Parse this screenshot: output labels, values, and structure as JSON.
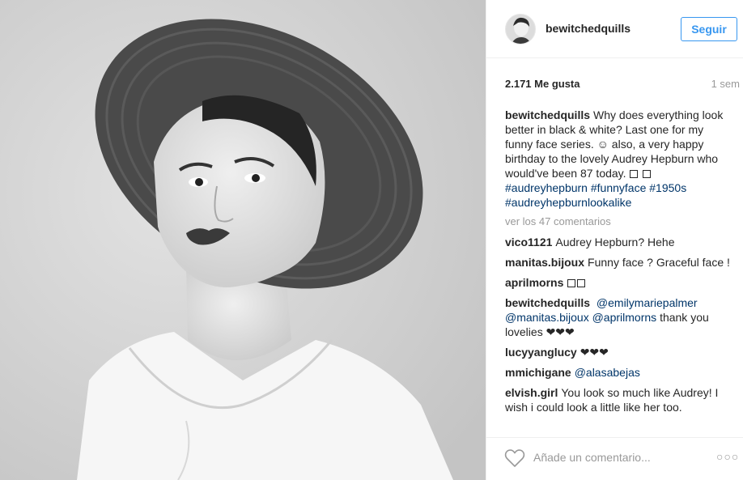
{
  "post": {
    "username": "bewitchedquills",
    "follow_label": "Seguir",
    "likes": "2.171 Me gusta",
    "time": "1 sem",
    "caption": {
      "user": "bewitchedquills",
      "text_1": "Why does everything look better in black & white? Last one for my funny face series. ☺ also, a very happy birthday to the lovely Audrey Hepburn who would've been 87 today.",
      "tags": [
        "#audreyhepburn",
        "#funnyface",
        "#1950s",
        "#audreyhepburnlookalike"
      ]
    },
    "view_more": "ver los 47 comentarios",
    "comments": [
      {
        "user": "vico1121",
        "text": "Audrey Hepburn? Hehe"
      },
      {
        "user": "manitas.bijoux",
        "text": "Funny face ? Graceful face !"
      },
      {
        "user": "aprilmorns",
        "text": ""
      },
      {
        "user": "bewitchedquills",
        "mentions": [
          "@emilymariepalmer",
          "@manitas.bijoux",
          "@aprilmorns"
        ],
        "text": "thank you lovelies ❤❤❤"
      },
      {
        "user": "lucyyanglucy",
        "text": "❤❤❤"
      },
      {
        "user": "mmichigane",
        "mention": "@alasabejas"
      },
      {
        "user": "elvish.girl",
        "text": "You look so much like Audrey! I wish i could look a little like her too."
      }
    ],
    "add_comment_placeholder": "Añade un comentario...",
    "options_label": "○○○"
  },
  "icons": {
    "like": "heart-outline-icon",
    "options": "more-options-icon"
  },
  "colors": {
    "accent": "#3897f0",
    "hashtag": "#003569",
    "muted": "#999999",
    "text": "#262626"
  }
}
